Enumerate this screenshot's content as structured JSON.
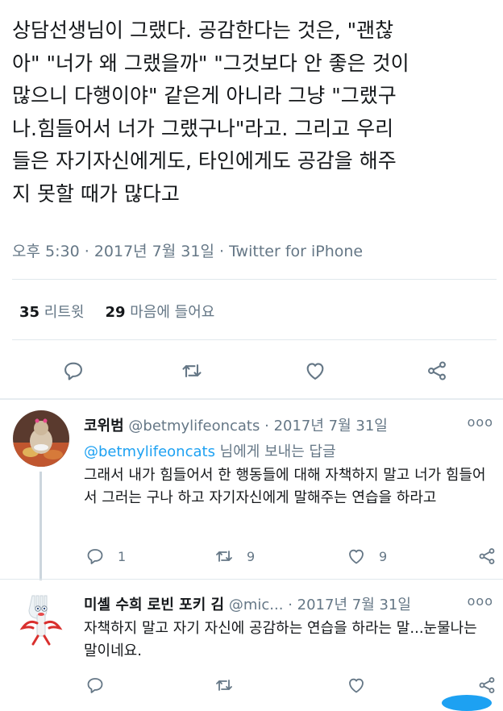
{
  "tweet": {
    "text": "상담선생님이 그랬다. 공감한다는 것은, \"괜찮\n아\" \"너가 왜 그랬을까\" \"그것보다 안 좋은 것이\n많으니 다행이야\" 같은게 아니라 그냥 \"그랬구\n나.힘들어서 너가 그랬구나\"라고. 그리고 우리\n들은 자기자신에게도, 타인에게도 공감을 해주\n지 못할 때가 많다고",
    "time": "오후 5:30",
    "date": "2017년 7월 31일",
    "source": "Twitter for iPhone",
    "retweet_count": "35",
    "retweet_label": "리트윗",
    "like_count": "29",
    "like_label": "마음에 들어요"
  },
  "replies": [
    {
      "name": "코위범",
      "handle": "@betmylifeoncats",
      "date": "2017년 7월 31일",
      "reply_to_mention": "@betmylifeoncats",
      "reply_to_suffix": " 님에게 보내는 답글",
      "text": "그래서 내가 힘들어서 한 행동들에 대해 자책하지 말고 너가 힘들어서 그러는 구나 하고 자기자신에게 말해주는 연습을 하라고",
      "reply_count": "1",
      "retweet_count": "9",
      "like_count": "9",
      "avatar": "cat-avatar"
    },
    {
      "name": "미셸 수희 로빈 포키 김",
      "handle": "@mic...",
      "date": "2017년 7월 31일",
      "text": "자책하지 말고 자기 자신에 공감하는 연습을 하라는 말...눈물나는 말이네요.",
      "avatar": "forky-avatar"
    }
  ],
  "icons": {
    "reply": "reply-icon",
    "retweet": "retweet-icon",
    "like": "heart-icon",
    "share": "share-icon",
    "more": "more-icon"
  },
  "colors": {
    "text": "#14171a",
    "muted": "#657786",
    "link": "#1da1f2",
    "divider": "#e1e8ed"
  },
  "more_glyph": "ooo",
  "separator": "·"
}
